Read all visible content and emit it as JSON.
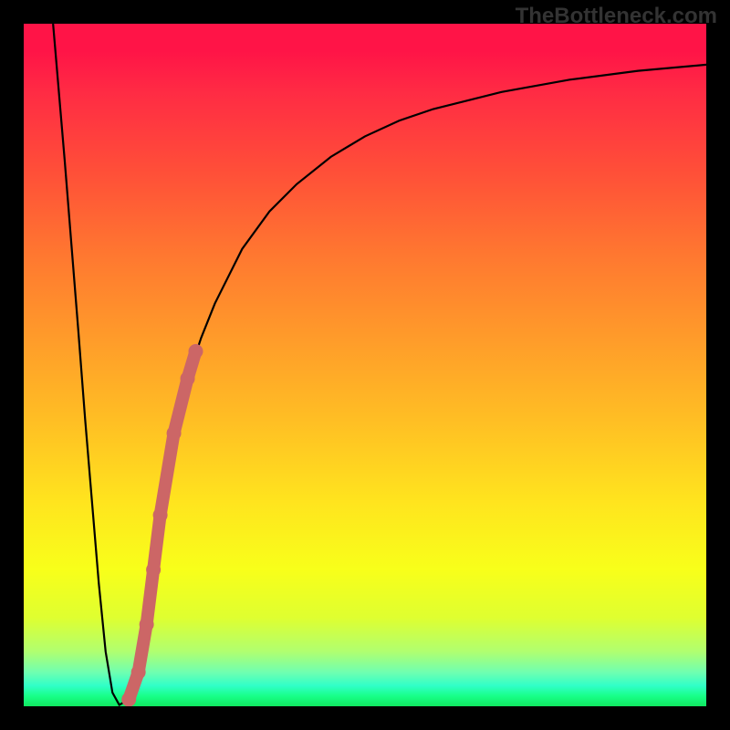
{
  "watermark": "TheBottleneck.com",
  "chart_data": {
    "type": "line",
    "title": "",
    "xlabel": "",
    "ylabel": "",
    "xlim": [
      0,
      100
    ],
    "ylim": [
      0,
      100
    ],
    "curve": {
      "x": [
        4.3,
        6,
        8,
        9,
        10,
        11,
        12,
        13,
        14,
        15.4,
        16.8,
        18,
        19,
        20,
        22,
        24,
        26,
        28,
        32,
        36,
        40,
        45,
        50,
        55,
        60,
        70,
        80,
        90,
        100
      ],
      "y": [
        100,
        80,
        55,
        42,
        30,
        18,
        8,
        2,
        0.2,
        1,
        5,
        12,
        20,
        28,
        40,
        48,
        54,
        59,
        67,
        72.5,
        76.5,
        80.5,
        83.5,
        85.8,
        87.5,
        90,
        91.8,
        93.1,
        94
      ]
    },
    "highlight_segment": {
      "x": [
        15.4,
        16.8,
        18,
        19,
        20,
        22,
        24,
        25.2
      ],
      "y": [
        1,
        5,
        12,
        20,
        28,
        40,
        48,
        52
      ]
    },
    "gradient_stops": [
      {
        "pct": 0,
        "color": "#ff1447"
      },
      {
        "pct": 22,
        "color": "#ff5038"
      },
      {
        "pct": 46,
        "color": "#ff9b2a"
      },
      {
        "pct": 70,
        "color": "#ffe41e"
      },
      {
        "pct": 87,
        "color": "#dfff30"
      },
      {
        "pct": 100,
        "color": "#10e860"
      }
    ]
  }
}
